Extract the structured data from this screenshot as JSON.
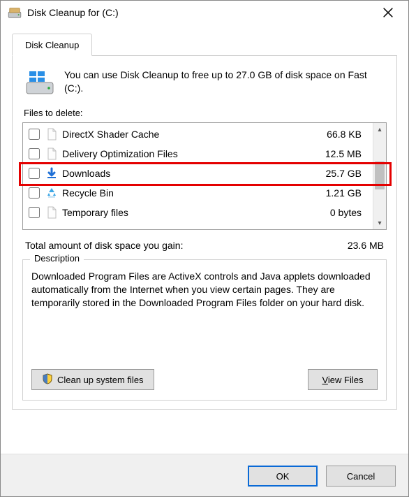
{
  "window": {
    "title": "Disk Cleanup for  (C:)"
  },
  "tab": {
    "label": "Disk Cleanup"
  },
  "intro": {
    "text": "You can use Disk Cleanup to free up to 27.0 GB of disk space on Fast (C:)."
  },
  "labels": {
    "files_to_delete": "Files to delete:",
    "total_gain": "Total amount of disk space you gain:",
    "description_caption": "Description"
  },
  "files": [
    {
      "name": "DirectX Shader Cache",
      "size": "66.8 KB",
      "checked": false,
      "icon": "file"
    },
    {
      "name": "Delivery Optimization Files",
      "size": "12.5 MB",
      "checked": false,
      "icon": "file"
    },
    {
      "name": "Downloads",
      "size": "25.7 GB",
      "checked": false,
      "icon": "download",
      "highlight": true
    },
    {
      "name": "Recycle Bin",
      "size": "1.21 GB",
      "checked": false,
      "icon": "recycle"
    },
    {
      "name": "Temporary files",
      "size": "0 bytes",
      "checked": false,
      "icon": "file"
    }
  ],
  "total_gain_value": "23.6 MB",
  "description": {
    "body": "Downloaded Program Files are ActiveX controls and Java applets downloaded automatically from the Internet when you view certain pages. They are temporarily stored in the Downloaded Program Files folder on your hard disk."
  },
  "buttons": {
    "clean_system": "Clean up system files",
    "view_files_pre": "",
    "view_files_underline": "V",
    "view_files_rest": "iew Files",
    "ok": "OK",
    "cancel": "Cancel"
  }
}
